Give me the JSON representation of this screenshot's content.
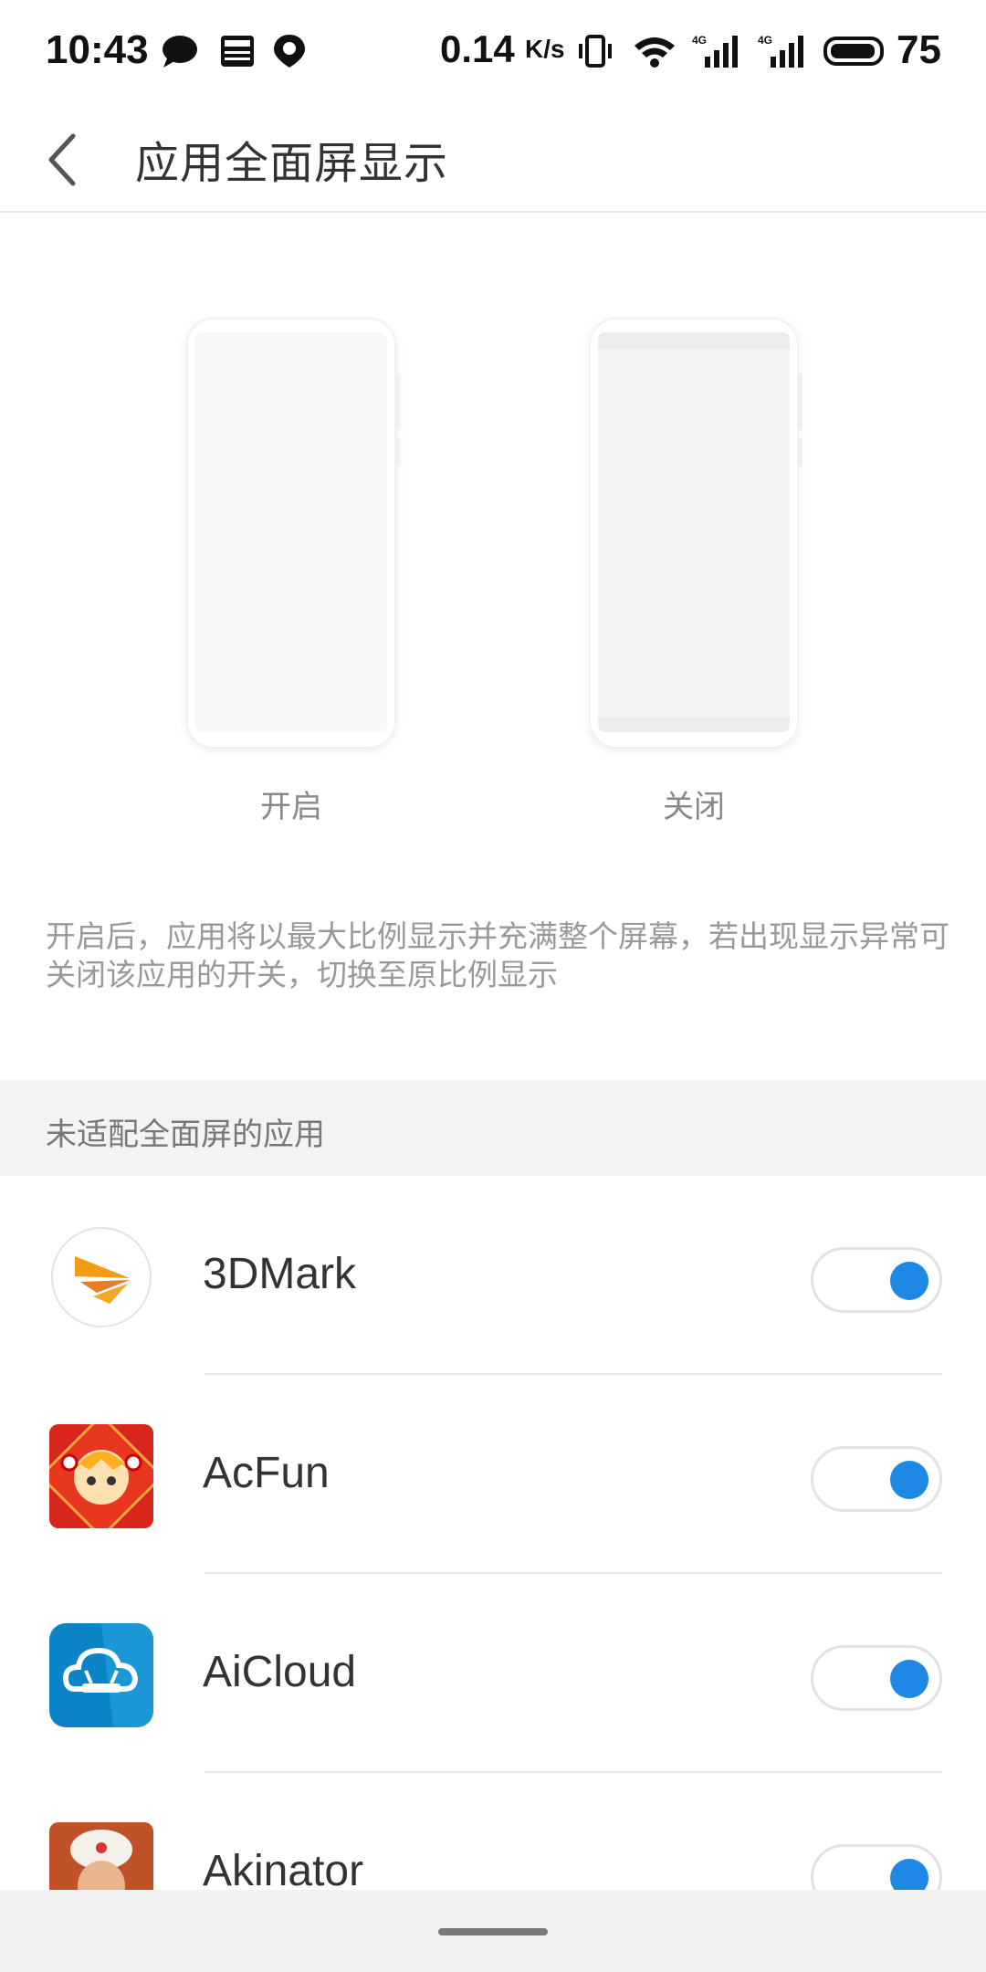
{
  "status_bar": {
    "time": "10:43",
    "speed": "0.14",
    "speed_unit": "K/s",
    "network_1": "4G",
    "network_2": "4G",
    "battery": "75",
    "icons": [
      "chat-icon",
      "news-icon",
      "du-map-icon",
      "vibrate-icon",
      "wifi-icon",
      "signal-icon",
      "battery-icon"
    ]
  },
  "header": {
    "title": "应用全面屏显示",
    "back_icon": "chevron-left-icon"
  },
  "illustration": {
    "on_label": "开启",
    "off_label": "关闭"
  },
  "description": "开启后，应用将以最大比例显示并充满整个屏幕，若出现显示异常可关闭该应用的开关，切换至原比例显示",
  "section": {
    "title": "未适配全面屏的应用"
  },
  "apps": [
    {
      "name": "3DMark",
      "enabled": true,
      "icon": "3dmark-icon"
    },
    {
      "name": "AcFun",
      "enabled": true,
      "icon": "acfun-icon"
    },
    {
      "name": "AiCloud",
      "enabled": true,
      "icon": "aicloud-icon"
    },
    {
      "name": "Akinator",
      "enabled": true,
      "icon": "akinator-icon"
    }
  ],
  "colors": {
    "accent": "#1e88e5",
    "toggle_border": "#e2e2e2",
    "section_bg": "#f3f3f3"
  }
}
